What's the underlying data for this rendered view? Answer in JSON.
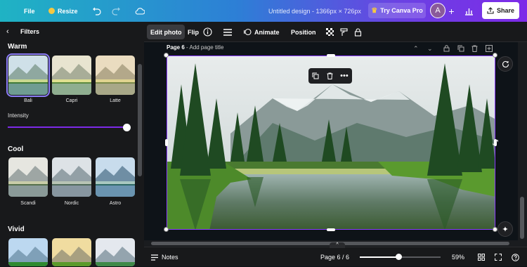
{
  "topbar": {
    "file_label": "File",
    "resize_label": "Resize",
    "doc_title": "Untitled design - 1366px × 726px",
    "try_pro_label": "Try Canva Pro",
    "avatar_initial": "A",
    "share_label": "Share"
  },
  "panel": {
    "title": "Filters",
    "sections": [
      {
        "title": "Warm",
        "items": [
          "Bali",
          "Capri",
          "Latte"
        ]
      },
      {
        "title": "Cool",
        "items": [
          "Scandi",
          "Nordic",
          "Astro"
        ]
      },
      {
        "title": "Vivid",
        "items": [
          "",
          "",
          ""
        ]
      }
    ],
    "intensity_label": "Intensity",
    "intensity_value": 1.0
  },
  "editbar": {
    "edit_photo": "Edit photo",
    "flip": "Flip",
    "animate": "Animate",
    "position": "Position"
  },
  "canvas": {
    "page_label": "Page 6",
    "page_title_placeholder": "- Add page title"
  },
  "bottombar": {
    "notes": "Notes",
    "page_indicator": "Page 6 / 6",
    "zoom": "59%",
    "zoom_fraction": 0.5
  },
  "colors": {
    "accent": "#7d2ae8",
    "selection": "#8b3dff"
  }
}
